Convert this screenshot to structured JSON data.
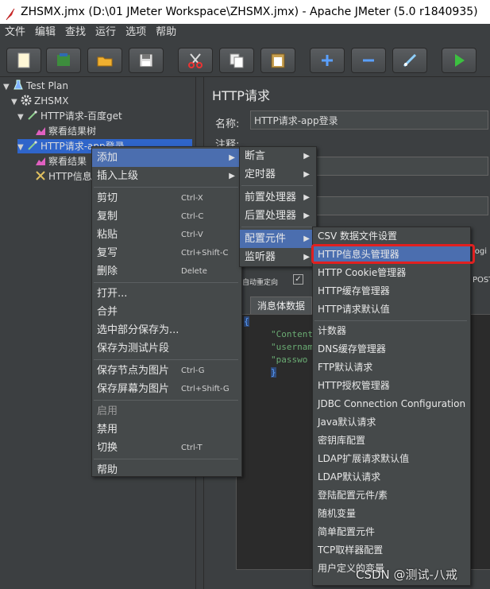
{
  "window": {
    "title": "ZHSMX.jmx (D:\\01 JMeter Workspace\\ZHSMX.jmx) - Apache JMeter (5.0 r1840935)"
  },
  "menubar": [
    "文件",
    "编辑",
    "查找",
    "运行",
    "选项",
    "帮助"
  ],
  "toolbar_icons": [
    "new-icon",
    "templates-icon",
    "open-icon",
    "save-icon",
    "cut-icon",
    "copy-icon",
    "paste-icon",
    "expand-icon",
    "collapse-icon",
    "toggle-icon",
    "start-icon"
  ],
  "tree": {
    "test_plan": "Test Plan",
    "thread_group": "ZHSMX",
    "req_baidu": "HTTP请求-百度get",
    "result_tree_1": "察看结果树",
    "req_app": "HTTP请求-app登录",
    "result_tree_2": "察看结果",
    "header_mgr": "HTTP信息"
  },
  "panel": {
    "title": "HTTP请求",
    "name_label": "名称:",
    "name_value": "HTTP请求-app登录",
    "comment_label": "注释:",
    "frag_log": "logi",
    "frag_post": "POST",
    "frag_redirect": "自动重定向",
    "body_tab": "消息体数据",
    "json_brace_open": "{",
    "json_lines": [
      "\"Content",
      "\"usernam",
      "\"passwo"
    ],
    "json_brace_close": "}"
  },
  "context_menu": [
    {
      "label": "添加",
      "submenu": true
    },
    {
      "label": "插入上级",
      "submenu": true
    },
    {
      "sep": true
    },
    {
      "label": "剪切",
      "shortcut": "Ctrl-X"
    },
    {
      "label": "复制",
      "shortcut": "Ctrl-C"
    },
    {
      "label": "粘贴",
      "shortcut": "Ctrl-V"
    },
    {
      "label": "复写",
      "shortcut": "Ctrl+Shift-C"
    },
    {
      "label": "删除",
      "shortcut": "Delete"
    },
    {
      "sep": true
    },
    {
      "label": "打开..."
    },
    {
      "label": "合并"
    },
    {
      "label": "选中部分保存为..."
    },
    {
      "label": "保存为测试片段"
    },
    {
      "sep": true
    },
    {
      "label": "保存节点为图片",
      "shortcut": "Ctrl-G"
    },
    {
      "label": "保存屏幕为图片",
      "shortcut": "Ctrl+Shift-G"
    },
    {
      "sep": true
    },
    {
      "label": "启用",
      "disabled": true
    },
    {
      "label": "禁用"
    },
    {
      "label": "切换",
      "shortcut": "Ctrl-T"
    },
    {
      "sep": true
    },
    {
      "label": "帮助"
    }
  ],
  "add_submenu": [
    {
      "label": "断言",
      "submenu": true
    },
    {
      "label": "定时器",
      "submenu": true
    },
    {
      "sep": true
    },
    {
      "label": "前置处理器",
      "submenu": true
    },
    {
      "label": "后置处理器",
      "submenu": true
    },
    {
      "sep": true
    },
    {
      "label": "配置元件",
      "submenu": true
    },
    {
      "label": "监听器",
      "submenu": true
    }
  ],
  "config_submenu": [
    "CSV 数据文件设置",
    "HTTP信息头管理器",
    "HTTP Cookie管理器",
    "HTTP缓存管理器",
    "HTTP请求默认值",
    "计数器",
    "DNS缓存管理器",
    "FTP默认请求",
    "HTTP授权管理器",
    "JDBC Connection Configuration",
    "Java默认请求",
    "密钥库配置",
    "LDAP扩展请求默认值",
    "LDAP默认请求",
    "登陆配置元件/素",
    "随机变量",
    "简单配置元件",
    "TCP取样器配置",
    "用户定义的变量"
  ],
  "watermark": "CSDN @测试-八戒",
  "colors": {
    "selection": "#4b6eaf",
    "highlight_box": "#e02020",
    "background": "#3c3f41"
  }
}
